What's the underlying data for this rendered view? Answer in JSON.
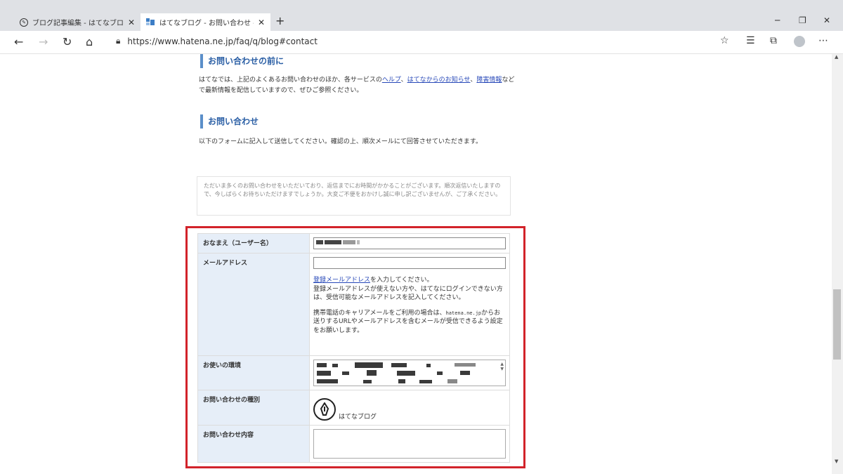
{
  "browser": {
    "tabs": [
      {
        "title": "ブログ記事編集 - はてなブログ",
        "active": false
      },
      {
        "title": "はてなブログ - お問い合わせ - はてな",
        "active": true
      }
    ],
    "url": "https://www.hatena.ne.jp/faq/q/blog#contact",
    "icons": [
      "back-icon",
      "forward-icon",
      "refresh-icon",
      "home-icon",
      "lock-icon",
      "favorite-star-icon",
      "favorites-list-icon",
      "collections-icon",
      "profile-icon",
      "more-icon",
      "close-icon",
      "plus-icon",
      "minimize-icon",
      "maximize-icon"
    ]
  },
  "page": {
    "section1": {
      "heading": "お問い合わせの前に",
      "text_before": "はてなでは、上記のよくあるお問い合わせのほか、各サービスの",
      "link_help": "ヘルプ",
      "sep1": "、",
      "link_news": "はてなからのお知らせ",
      "sep2": "、",
      "link_incident": "障害情報",
      "text_after": "などで最新情報を配信していますので、ぜひご参照ください。"
    },
    "section2": {
      "heading": "お問い合わせ",
      "text": "以下のフォームに記入して送信してください。確認の上、順次メールにて回答させていただきます。",
      "notice": "ただいま多くのお問い合わせをいただいており、返信までにお時間がかかることがございます。順次返信いたしますので、今しばらくお待ちいただけますでしょうか。大変ご不便をおかけし誠に申し訳ございませんが、ご了承ください。"
    },
    "form": {
      "name_label": "おなまえ（ユーザー名）",
      "email_label": "メールアドレス",
      "email_help_link": "登録メールアドレス",
      "email_help_1": "を入力してください。",
      "email_help_2": "登録メールアドレスが使えない方や、はてなにログインできない方は、受信可能なメールアドレスを記入してください。",
      "email_help_3a": "携帯電話のキャリアメールをご利用の場合は、",
      "email_help_domain": "hatena.ne.jp",
      "email_help_3b": "からお送りするURLやメールアドレスを含むメールが受信できるよう設定をお願いします。",
      "env_label": "お使いの環境",
      "type_label": "お問い合わせの種別",
      "service_name": "はてなブログ",
      "content_label": "お問い合わせ内容"
    }
  },
  "colors": {
    "accent": "#5b8fc9",
    "heading": "#2b5fa5",
    "highlight": "#d2232a",
    "label_bg": "#e6eef8"
  }
}
